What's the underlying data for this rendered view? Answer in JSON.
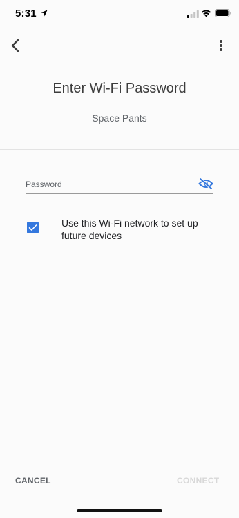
{
  "status_bar": {
    "time": "5:31"
  },
  "icons": {
    "back": "chevron-left-icon",
    "more": "more-vert-icon",
    "visibility": "visibility-off-icon",
    "check": "check-icon",
    "location": "location-arrow-icon",
    "signal": "cellular-signal-icon",
    "wifi": "wifi-icon",
    "battery": "battery-icon"
  },
  "header": {
    "title": "Enter Wi-Fi Password",
    "network_name": "Space Pants"
  },
  "password": {
    "placeholder": "Password",
    "value": ""
  },
  "remember": {
    "checked": true,
    "label": "Use this Wi-Fi network to set up future devices"
  },
  "actions": {
    "cancel_label": "CANCEL",
    "connect_label": "CONNECT"
  },
  "colors": {
    "accent": "#3478de",
    "disabled_text": "#d8d8d8",
    "secondary_text": "#5f6368"
  }
}
